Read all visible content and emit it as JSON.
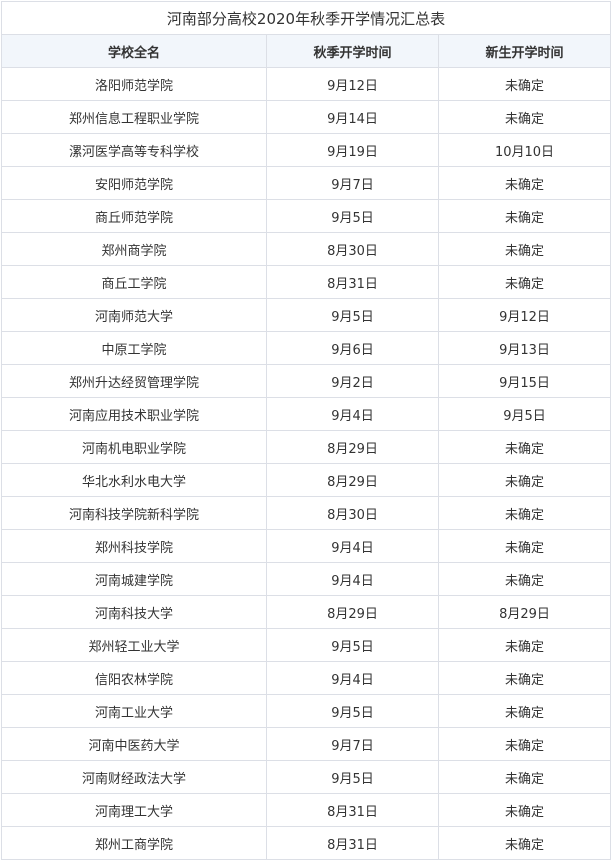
{
  "table": {
    "title": "河南部分高校2020年秋季开学情况汇总表",
    "headers": [
      "学校全名",
      "秋季开学时间",
      "新生开学时间"
    ],
    "rows": [
      [
        "洛阳师范学院",
        "9月12日",
        "未确定"
      ],
      [
        "郑州信息工程职业学院",
        "9月14日",
        "未确定"
      ],
      [
        "漯河医学高等专科学校",
        "9月19日",
        "10月10日"
      ],
      [
        "安阳师范学院",
        "9月7日",
        "未确定"
      ],
      [
        "商丘师范学院",
        "9月5日",
        "未确定"
      ],
      [
        "郑州商学院",
        "8月30日",
        "未确定"
      ],
      [
        "商丘工学院",
        "8月31日",
        "未确定"
      ],
      [
        "河南师范大学",
        "9月5日",
        "9月12日"
      ],
      [
        "中原工学院",
        "9月6日",
        "9月13日"
      ],
      [
        "郑州升达经贸管理学院",
        "9月2日",
        "9月15日"
      ],
      [
        "河南应用技术职业学院",
        "9月4日",
        "9月5日"
      ],
      [
        "河南机电职业学院",
        "8月29日",
        "未确定"
      ],
      [
        "华北水利水电大学",
        "8月29日",
        "未确定"
      ],
      [
        "河南科技学院新科学院",
        "8月30日",
        "未确定"
      ],
      [
        "郑州科技学院",
        "9月4日",
        "未确定"
      ],
      [
        "河南城建学院",
        "9月4日",
        "未确定"
      ],
      [
        "河南科技大学",
        "8月29日",
        "8月29日"
      ],
      [
        "郑州轻工业大学",
        "9月5日",
        "未确定"
      ],
      [
        "信阳农林学院",
        "9月4日",
        "未确定"
      ],
      [
        "河南工业大学",
        "9月5日",
        "未确定"
      ],
      [
        "河南中医药大学",
        "9月7日",
        "未确定"
      ],
      [
        "河南财经政法大学",
        "9月5日",
        "未确定"
      ],
      [
        "河南理工大学",
        "8月31日",
        "未确定"
      ],
      [
        "郑州工商学院",
        "8月31日",
        "未确定"
      ]
    ]
  }
}
